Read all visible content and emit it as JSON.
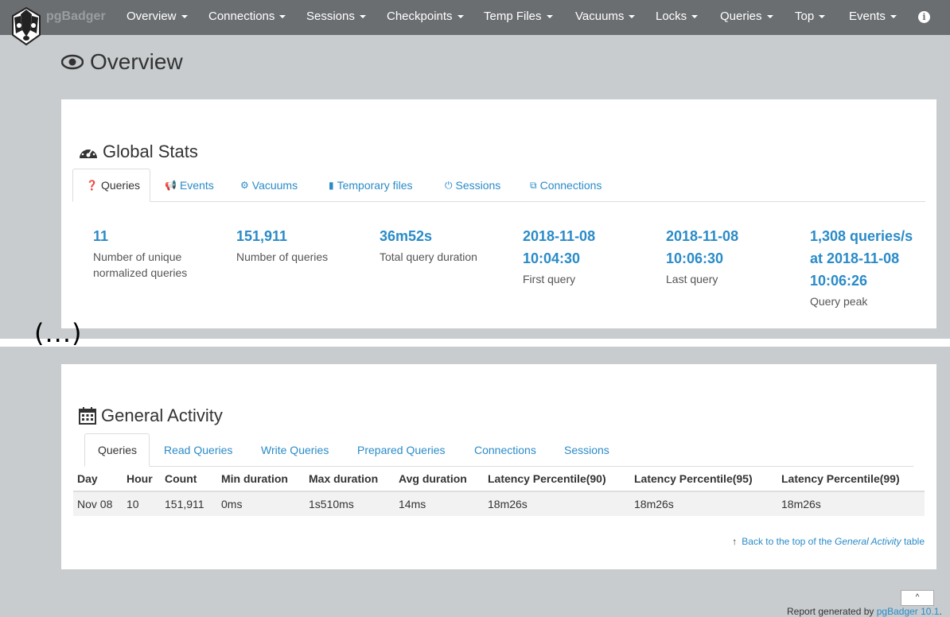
{
  "navbar": {
    "brand": "pgBadger",
    "items": [
      {
        "label": "Overview"
      },
      {
        "label": "Connections"
      },
      {
        "label": "Sessions"
      },
      {
        "label": "Checkpoints"
      },
      {
        "label": "Temp Files"
      },
      {
        "label": "Vacuums"
      },
      {
        "label": "Locks"
      },
      {
        "label": "Queries"
      },
      {
        "label": "Top"
      },
      {
        "label": "Events"
      }
    ],
    "info_icon": "info-circle-icon"
  },
  "page_title": "Overview",
  "global_stats": {
    "heading": "Global Stats",
    "tabs": [
      {
        "label": "Queries",
        "icon": "question-circle-icon"
      },
      {
        "label": "Events",
        "icon": "bullhorn-icon"
      },
      {
        "label": "Vacuums",
        "icon": "cogs-icon"
      },
      {
        "label": "Temporary files",
        "icon": "file-icon"
      },
      {
        "label": "Sessions",
        "icon": "power-icon"
      },
      {
        "label": "Connections",
        "icon": "external-link-icon"
      }
    ],
    "stats": [
      {
        "value": "11",
        "label": "Number of unique normalized queries"
      },
      {
        "value": "151,911",
        "label": "Number of queries"
      },
      {
        "value": "36m52s",
        "label": "Total query duration"
      },
      {
        "value": "2018-11-08 10:04:30",
        "label": "First query"
      },
      {
        "value": "2018-11-08 10:06:30",
        "label": "Last query"
      },
      {
        "value": "1,308 queries/s at 2018-11-08 10:06:26",
        "label": "Query peak"
      }
    ]
  },
  "ellipsis": "(...)",
  "general_activity": {
    "heading": "General Activity",
    "tabs": [
      "Queries",
      "Read Queries",
      "Write Queries",
      "Prepared Queries",
      "Connections",
      "Sessions"
    ],
    "columns": [
      "Day",
      "Hour",
      "Count",
      "Min duration",
      "Max duration",
      "Avg duration",
      "Latency Percentile(90)",
      "Latency Percentile(95)",
      "Latency Percentile(99)"
    ],
    "rows": [
      [
        "Nov 08",
        "10",
        "151,911",
        "0ms",
        "1s510ms",
        "14ms",
        "18m26s",
        "18m26s",
        "18m26s"
      ]
    ],
    "back_link_prefix": "Back to the top of the ",
    "back_link_em": "General Activity",
    "back_link_suffix": " table"
  },
  "footer": {
    "prefix": "Report generated by ",
    "link": "pgBadger 10.1",
    "suffix": "."
  },
  "scroll_top_label": "^"
}
